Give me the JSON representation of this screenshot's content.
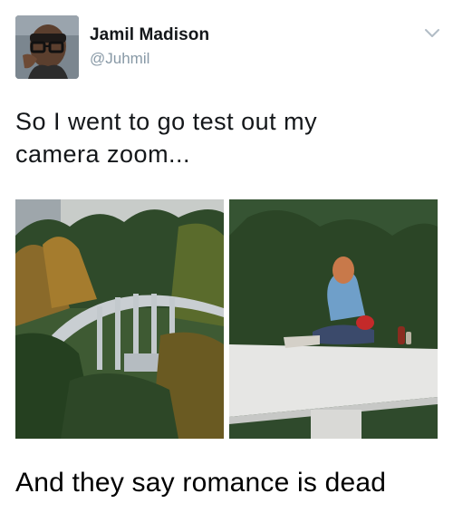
{
  "tweet": {
    "author_name": "Jamil Madison",
    "author_handle": "@Juhmil",
    "text": "So I went to go test out my camera zoom...",
    "text_line1": "So I went to go test out my",
    "text_line2": "camera zoom..."
  },
  "icons": {
    "menu": "chevron-down-icon",
    "avatar": "avatar"
  },
  "media": {
    "left": "photo of a distant arched bridge among trees",
    "right": "zoomed photo of people on the bridge roof"
  },
  "caption": "And they say romance is dead",
  "colors": {
    "name": "#14171a",
    "handle": "#8899a6",
    "chevron": "#b1bcc5"
  }
}
